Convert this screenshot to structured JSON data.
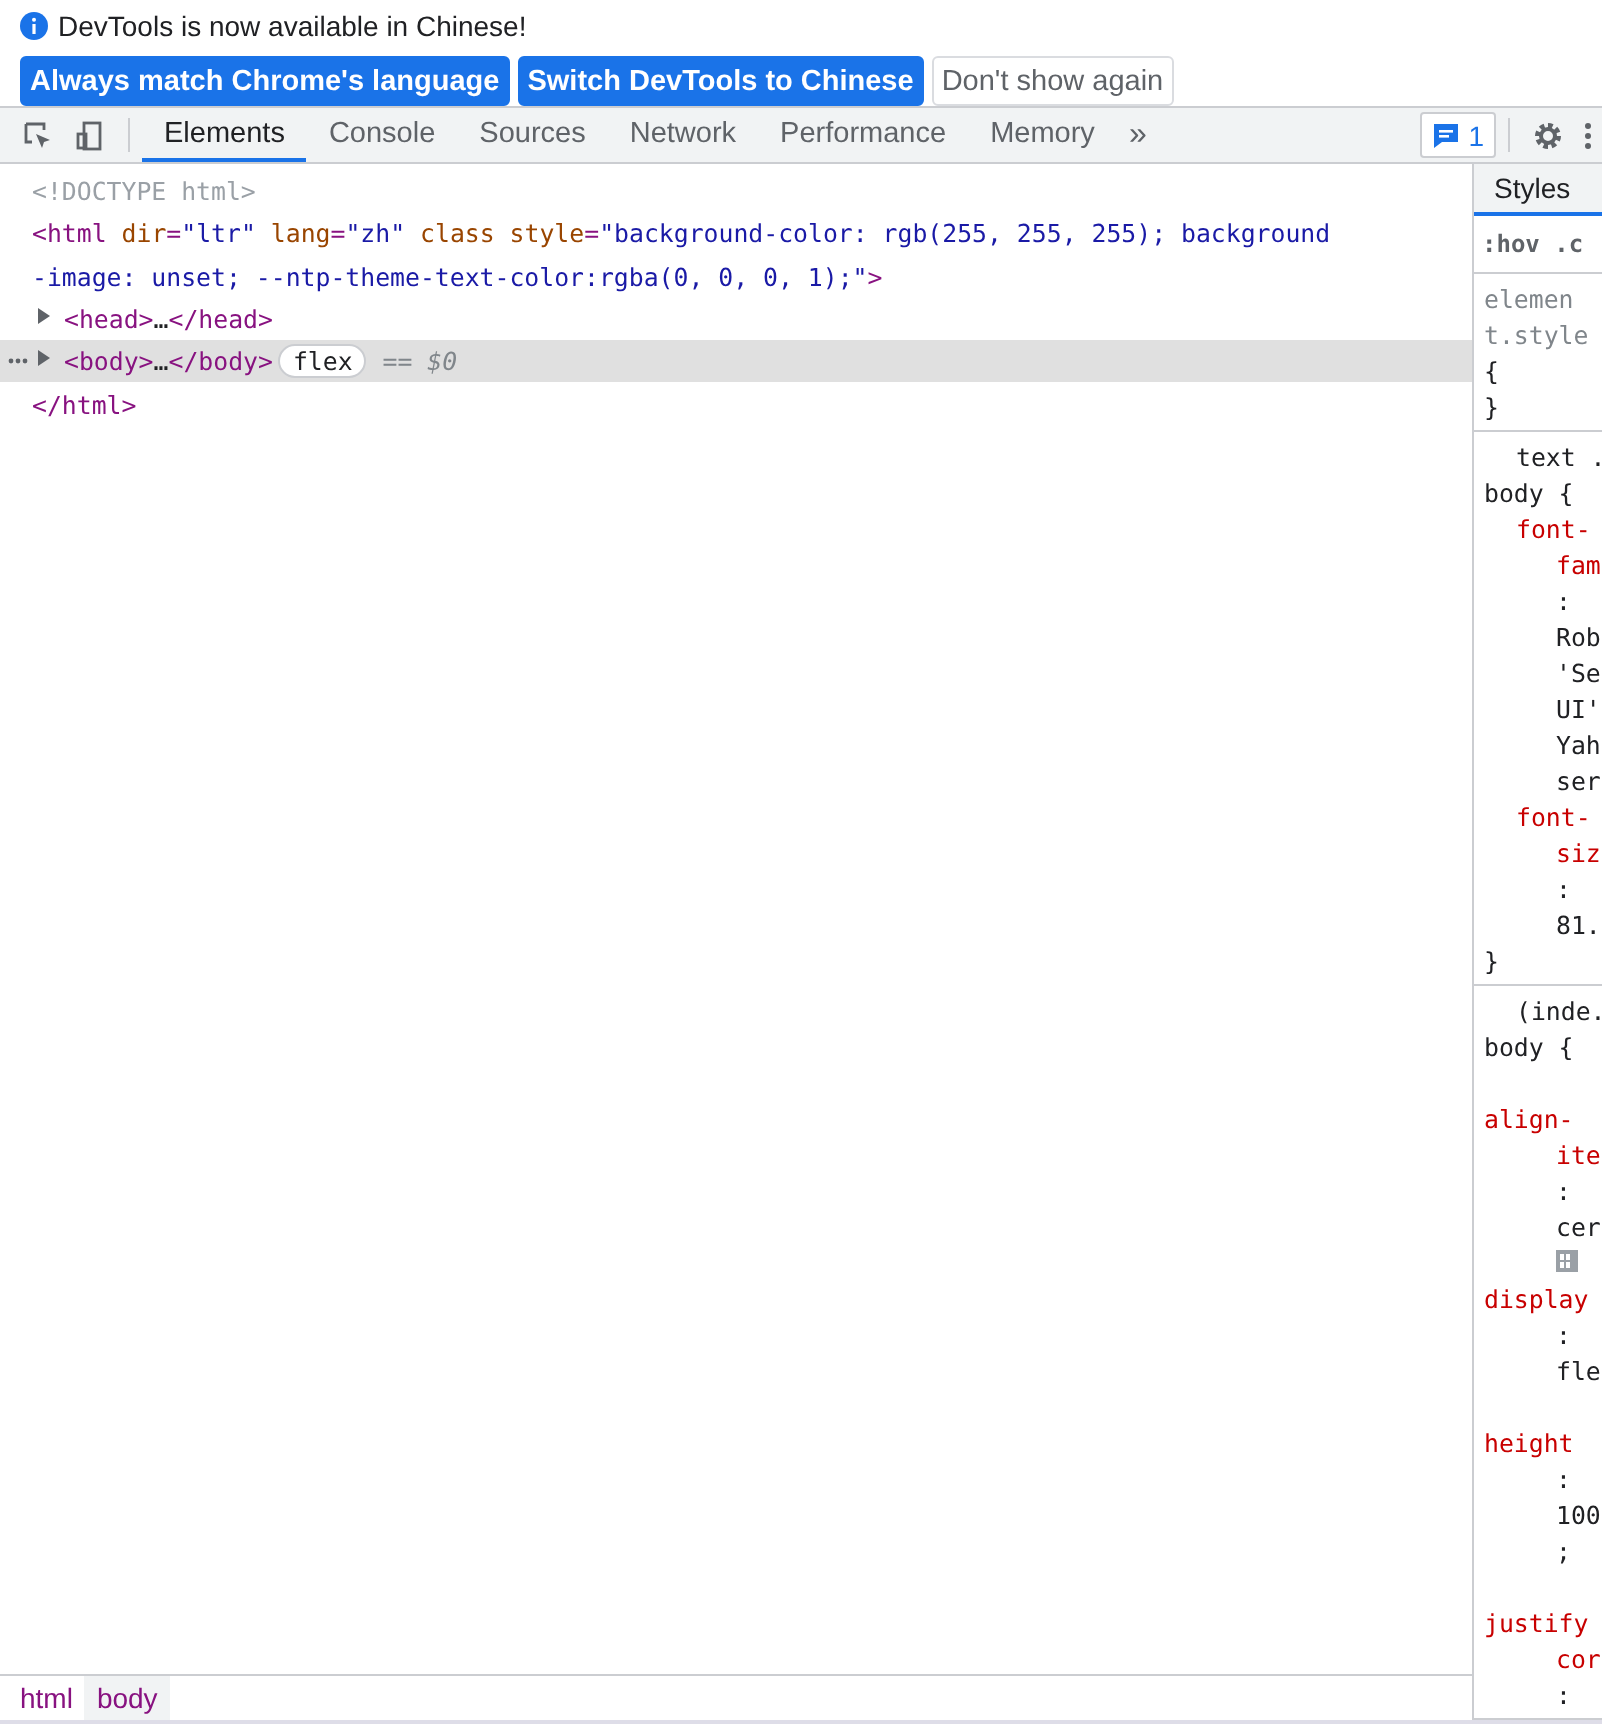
{
  "infobar": {
    "message": "DevTools is now available in Chinese!",
    "buttons": [
      {
        "label": "Always match Chrome's language",
        "kind": "primary"
      },
      {
        "label": "Switch DevTools to Chinese",
        "kind": "primary"
      },
      {
        "label": "Don't show again",
        "kind": "secondary"
      }
    ]
  },
  "toolbar": {
    "tabs": [
      {
        "label": "Elements",
        "selected": true
      },
      {
        "label": "Console",
        "selected": false
      },
      {
        "label": "Sources",
        "selected": false
      },
      {
        "label": "Network",
        "selected": false
      },
      {
        "label": "Performance",
        "selected": false
      },
      {
        "label": "Memory",
        "selected": false
      }
    ],
    "more": "»",
    "issues_count": "1"
  },
  "elements": {
    "lines": [
      {
        "kind": "plain",
        "selected": false,
        "tokens": [
          {
            "kind": "doctype",
            "text": "<!DOCTYPE html>"
          }
        ]
      },
      {
        "kind": "plain",
        "selected": false,
        "tokens": [
          {
            "kind": "tag",
            "text": "<html"
          },
          {
            "kind": "attr",
            "text": " dir"
          },
          {
            "kind": "tag",
            "text": "="
          },
          {
            "kind": "value",
            "text": "\"ltr\""
          },
          {
            "kind": "attr",
            "text": " lang"
          },
          {
            "kind": "tag",
            "text": "="
          },
          {
            "kind": "value",
            "text": "\"zh\""
          },
          {
            "kind": "attr",
            "text": " class"
          },
          {
            "kind": "attr",
            "text": " style"
          },
          {
            "kind": "tag",
            "text": "="
          },
          {
            "kind": "value",
            "text": "\"background-color: rgb(255, 255, 255); background"
          }
        ]
      },
      {
        "kind": "plain",
        "selected": false,
        "tokens": [
          {
            "kind": "value",
            "text": "-image: unset; --ntp-theme-text-color:rgba(0, 0, 0, 1);\""
          },
          {
            "kind": "tag",
            "text": ">"
          }
        ]
      },
      {
        "kind": "collapsed",
        "selected": false,
        "tokens": [
          {
            "kind": "tag",
            "text": "<head>"
          },
          {
            "kind": "plainword",
            "text": "…"
          },
          {
            "kind": "tag",
            "text": "</head>"
          }
        ]
      },
      {
        "kind": "collapsed",
        "selected": true,
        "tokens": [
          {
            "kind": "tag",
            "text": "<body>"
          },
          {
            "kind": "plainword",
            "text": "…"
          },
          {
            "kind": "tag",
            "text": "</body>"
          },
          {
            "kind": "badge",
            "text": "flex"
          },
          {
            "kind": "hint",
            "text": "== $0"
          }
        ]
      },
      {
        "kind": "plain",
        "selected": false,
        "tokens": [
          {
            "kind": "tag",
            "text": "</html>"
          }
        ]
      }
    ]
  },
  "breadcrumbs": [
    {
      "label": "html",
      "selected": false
    },
    {
      "label": "body",
      "selected": true
    }
  ],
  "styles": {
    "tab": "Styles",
    "filter": ":hov .c",
    "sections": [
      {
        "lines": [
          {
            "kind": "muted",
            "text": "elemen"
          },
          {
            "kind": "muted",
            "text": "t.style"
          },
          {
            "kind": "brace",
            "text": "{"
          },
          {
            "kind": "brace",
            "text": "}"
          }
        ]
      },
      {
        "lines": [
          {
            "kind": "source",
            "text": "text ."
          },
          {
            "kind": "selector",
            "text": "body {"
          },
          {
            "kind": "prop",
            "text": "font-"
          },
          {
            "kind": "subprop",
            "text": "fam"
          },
          {
            "kind": "value",
            "text": ":"
          },
          {
            "kind": "value",
            "text": "Rob"
          },
          {
            "kind": "value",
            "text": "'Se"
          },
          {
            "kind": "value",
            "text": "UI'"
          },
          {
            "kind": "value",
            "text": "Yah"
          },
          {
            "kind": "value",
            "text": "ser"
          },
          {
            "kind": "prop",
            "text": "font-"
          },
          {
            "kind": "subprop",
            "text": "siz"
          },
          {
            "kind": "value",
            "text": ":"
          },
          {
            "kind": "value",
            "text": "81."
          },
          {
            "kind": "brace",
            "text": "}"
          }
        ]
      },
      {
        "lines": [
          {
            "kind": "source",
            "text": "(inde."
          },
          {
            "kind": "selector",
            "text": "body {"
          },
          {
            "kind": "gap"
          },
          {
            "kind": "toprop",
            "text": "align-"
          },
          {
            "kind": "subprop",
            "text": "ite"
          },
          {
            "kind": "value",
            "text": ":"
          },
          {
            "kind": "value",
            "text": "cer"
          },
          {
            "kind": "icon"
          },
          {
            "kind": "toprop",
            "text": "display"
          },
          {
            "kind": "value",
            "text": ":"
          },
          {
            "kind": "value",
            "text": "fle"
          },
          {
            "kind": "gap"
          },
          {
            "kind": "toprop",
            "text": "height"
          },
          {
            "kind": "value",
            "text": ":"
          },
          {
            "kind": "value",
            "text": "100"
          },
          {
            "kind": "value",
            "text": ";"
          },
          {
            "kind": "gap"
          },
          {
            "kind": "toprop",
            "text": "justify"
          },
          {
            "kind": "subprop",
            "text": "cor"
          },
          {
            "kind": "value",
            "text": ":"
          }
        ]
      }
    ]
  }
}
